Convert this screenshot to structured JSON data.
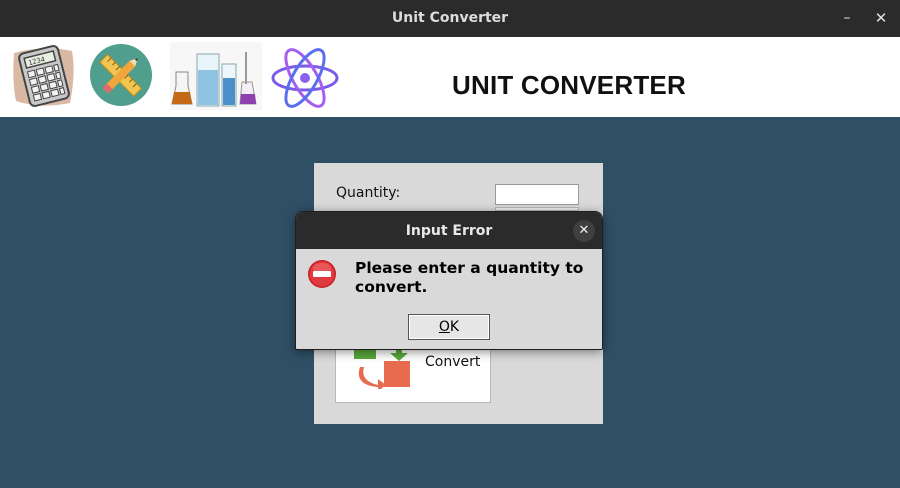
{
  "window": {
    "title": "Unit Converter",
    "minimize_glyph": "–",
    "close_glyph": "✕"
  },
  "banner": {
    "title": "UNIT CONVERTER",
    "images": [
      "calculator-icon",
      "ruler-pencil-icon",
      "lab-flasks-icon",
      "atom-icon"
    ]
  },
  "form": {
    "quantity_label": "Quantity:",
    "quantity_value": "",
    "convert_label": "Convert",
    "convert_icon": "convert-arrows-icon"
  },
  "dialog": {
    "title": "Input Error",
    "close_glyph": "✕",
    "icon": "error-icon",
    "message": "Please enter a quantity to convert.",
    "ok_label": "OK",
    "ok_mnemonic": "O",
    "ok_rest": "K"
  },
  "colors": {
    "titlebar": "#2b2b2b",
    "main_background": "#2f4f65",
    "panel": "#d9d9d9",
    "error_red": "#d8262b"
  }
}
